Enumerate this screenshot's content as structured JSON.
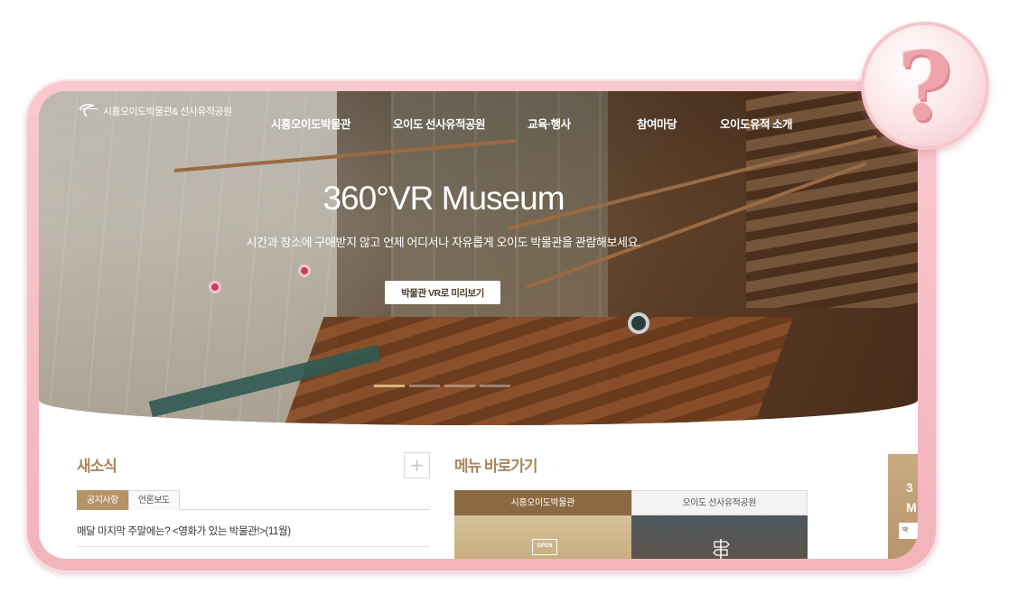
{
  "header": {
    "logo_text": "시흥오이도박물관& 선사유적공원",
    "nav": [
      {
        "label": "시흥오이도박물관"
      },
      {
        "label": "오이도 선사유적공원"
      },
      {
        "label": "교육·행사"
      },
      {
        "label": "참여마당"
      },
      {
        "label": "오이도유적 소개"
      }
    ]
  },
  "hero": {
    "title": "360°VR Museum",
    "subtitle": "시간과 장소에 구애받지 않고 언제 어디서나 자유롭게 오이도 박물관을 관람해보세요.",
    "button_label": "박물관 VR로 미리보기",
    "slide_count": 4,
    "active_slide": 1
  },
  "news": {
    "title": "새소식",
    "more_label": "+",
    "tabs": [
      {
        "label": "공지사항",
        "active": true
      },
      {
        "label": "언론보도",
        "active": false
      }
    ],
    "items": [
      {
        "text": "매달 마지막 주말에는? <영화가 있는 박물관!>(11월)"
      }
    ]
  },
  "menu_shortcuts": {
    "title": "메뉴 바로가기",
    "tabs": [
      {
        "label": "시흥오이도박물관",
        "active": true
      },
      {
        "label": "오이도 선사유적공원",
        "active": false
      }
    ],
    "open_sign": "OPEN"
  },
  "side_promo": {
    "text_line1": "3",
    "text_line2": "M",
    "button_label": "박"
  },
  "badge": {
    "symbol": "?"
  },
  "colors": {
    "frame_pink": "#f3b3bb",
    "accent_gold": "#a8865b",
    "tab_active_brown": "#8b6a43",
    "slide_active": "#d9b47a"
  }
}
